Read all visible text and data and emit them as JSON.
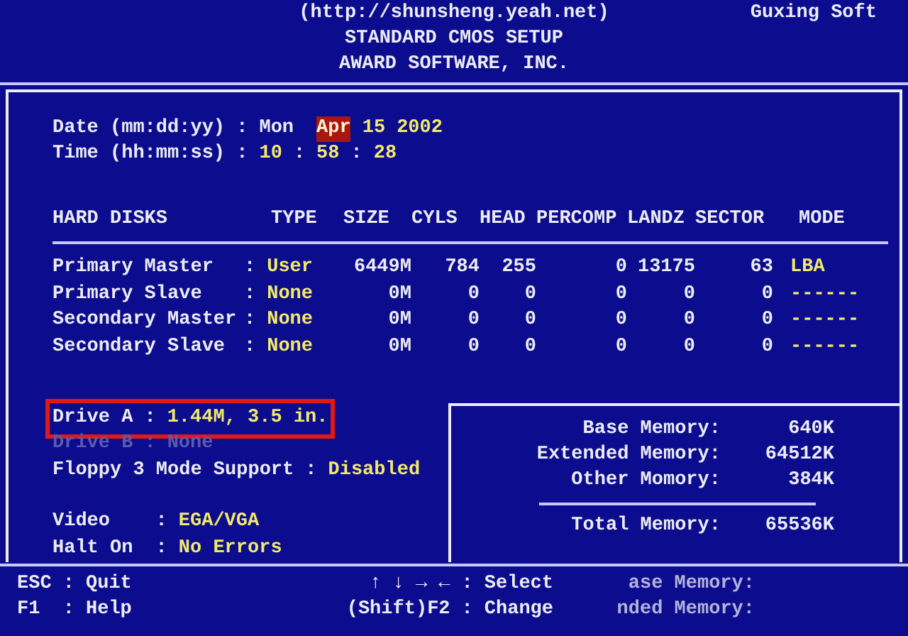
{
  "header": {
    "url": "(http://shunsheng.yeah.net)",
    "brand": "Guxing Soft",
    "title": "STANDARD CMOS SETUP",
    "company": "AWARD SOFTWARE, INC."
  },
  "date": {
    "label": "Date (mm:dd:yy) :",
    "weekday": "Mon",
    "parts": [
      {
        "text": "Apr",
        "selected": true
      },
      {
        "text": "15",
        "selected": false
      },
      {
        "text": "2002",
        "selected": false
      }
    ]
  },
  "time": {
    "label": "Time (hh:mm:ss) :",
    "parts": [
      {
        "text": "10",
        "kind": "value"
      },
      {
        "text": ":",
        "kind": "separator"
      },
      {
        "text": "58",
        "kind": "value"
      },
      {
        "text": ":",
        "kind": "separator"
      },
      {
        "text": "28",
        "kind": "value"
      }
    ]
  },
  "hard_disks": {
    "columns": [
      "HARD DISKS",
      "TYPE",
      "SIZE",
      "CYLS",
      "HEAD",
      "PERCOMP",
      "LANDZ",
      "SECTOR",
      "MODE"
    ],
    "rows": [
      {
        "name": "Primary Master",
        "colon": ":",
        "type": "User",
        "size": "6449M",
        "cyls": "784",
        "head": "255",
        "precomp": "0",
        "landz": "13175",
        "sector": "63",
        "mode": "LBA"
      },
      {
        "name": "Primary Slave",
        "colon": ":",
        "type": "None",
        "size": "0M",
        "cyls": "0",
        "head": "0",
        "precomp": "0",
        "landz": "0",
        "sector": "0",
        "mode": "------"
      },
      {
        "name": "Secondary Master",
        "colon": ":",
        "type": "None",
        "size": "0M",
        "cyls": "0",
        "head": "0",
        "precomp": "0",
        "landz": "0",
        "sector": "0",
        "mode": "------"
      },
      {
        "name": "Secondary Slave",
        "colon": ":",
        "type": "None",
        "size": "0M",
        "cyls": "0",
        "head": "0",
        "precomp": "0",
        "landz": "0",
        "sector": "0",
        "mode": "------"
      }
    ]
  },
  "settings": [
    {
      "label": "Drive A",
      "colon": ":",
      "value": "1.44M, 3.5 in.",
      "highlighted": true,
      "dimmed": false,
      "kind": "setting"
    },
    {
      "label": "Drive B",
      "colon": ":",
      "value": "None",
      "highlighted": false,
      "dimmed": true,
      "kind": "setting"
    },
    {
      "label": "Floppy 3 Mode Support",
      "colon": ":",
      "value": "Disabled",
      "highlighted": false,
      "dimmed": false,
      "kind": "setting"
    },
    {
      "kind": "gap"
    },
    {
      "label": "Video",
      "colon": ":",
      "value": "EGA/VGA",
      "highlighted": false,
      "dimmed": false,
      "kind": "aligned"
    },
    {
      "label": "Halt On",
      "colon": ":",
      "value": "No Errors",
      "highlighted": false,
      "dimmed": false,
      "kind": "aligned"
    }
  ],
  "memory": {
    "items": [
      {
        "label": "Base Memory:",
        "value": "640K"
      },
      {
        "label": "Extended Memory:",
        "value": "64512K"
      },
      {
        "label": "Other Momory:",
        "value": "384K"
      }
    ],
    "total": {
      "label": "Total Memory:",
      "value": "65536K"
    }
  },
  "footer": {
    "keys": [
      {
        "key": "ESC",
        "colon": ":",
        "action": "Quit"
      },
      {
        "key": "F1",
        "colon": ":",
        "action": "Help"
      }
    ],
    "nav": [
      {
        "key": "↑ ↓ → ←",
        "colon": ":",
        "action": "Select"
      },
      {
        "key": "(Shift)F2",
        "colon": ":",
        "action": "Change"
      }
    ],
    "ghost": [
      "ase Memory:",
      "nded Memory:"
    ]
  }
}
